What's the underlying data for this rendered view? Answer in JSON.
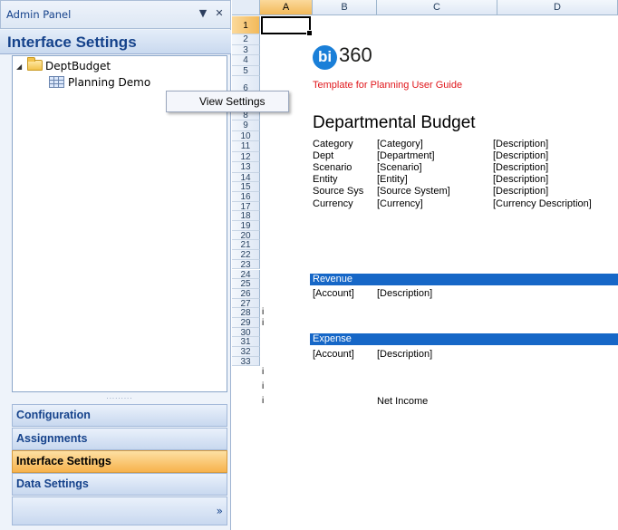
{
  "admin_panel": {
    "title": "Admin Panel",
    "pin_glyph": "▼",
    "close_glyph": "✕",
    "section_title": "Interface Settings",
    "tree": [
      {
        "label": "DeptBudget",
        "icon": "folder-icon",
        "expanded": true
      },
      {
        "label": "Planning Demo",
        "icon": "grid-icon"
      }
    ],
    "context_menu": [
      "View Settings"
    ],
    "splitter_glyph": ".........",
    "nav": [
      {
        "label": "Configuration",
        "active": false
      },
      {
        "label": "Assignments",
        "active": false
      },
      {
        "label": "Interface Settings",
        "active": true
      },
      {
        "label": "Data Settings",
        "active": false
      }
    ],
    "more_glyph": "»"
  },
  "sheet": {
    "columns": [
      "A",
      "B",
      "C",
      "D"
    ],
    "rows": [
      "1",
      "2",
      "3",
      "4",
      "5",
      "6",
      "7",
      "8",
      "9",
      "10",
      "11",
      "12",
      "13",
      "14",
      "15",
      "16",
      "17",
      "18",
      "19",
      "20",
      "21",
      "22",
      "23",
      "24",
      "25",
      "26",
      "27",
      "28",
      "29",
      "30",
      "31",
      "32",
      "33"
    ],
    "active_cell": "A1",
    "col_a_marks": [
      "i",
      "i",
      "i",
      "i",
      "i"
    ],
    "logo_mark": "bi",
    "logo_text": "360",
    "template_note": "Template for Planning User Guide",
    "report_title": "Departmental Budget",
    "header_rows": [
      [
        "Category",
        "[Category]",
        "[Description]"
      ],
      [
        "Dept",
        "[Department]",
        "[Description]"
      ],
      [
        "Scenario",
        "[Scenario]",
        "[Description]"
      ],
      [
        "Entity",
        "[Entity]",
        "[Description]"
      ],
      [
        "Source Sys",
        "[Source System]",
        "[Description]"
      ],
      [
        "Currency",
        "[Currency]",
        "[Currency Description]"
      ]
    ],
    "sections": [
      {
        "label": "Revenue",
        "account": "[Account]",
        "description": "[Description]"
      },
      {
        "label": "Expense",
        "account": "[Account]",
        "description": "[Description]"
      }
    ],
    "net_income": "Net Income",
    "colors": {
      "band": "#1667c7",
      "template_note": "#e0161b",
      "logo": "#1a7fd8",
      "active_tab": "#f7b24c"
    }
  }
}
